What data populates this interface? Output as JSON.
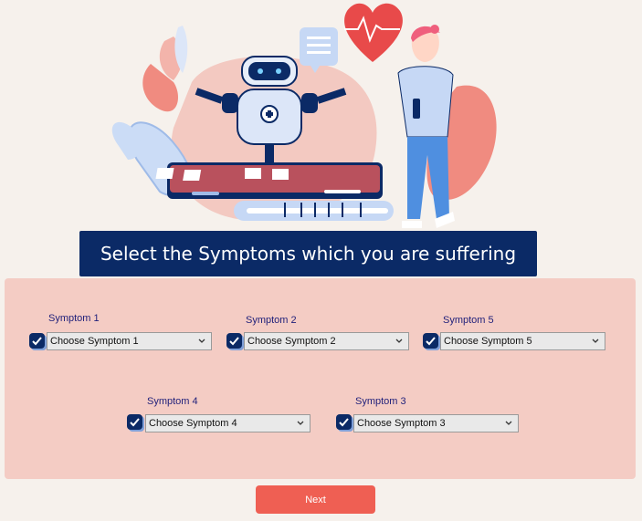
{
  "header": {
    "title": "Select the Symptoms which you are suffering"
  },
  "fields": [
    {
      "id": "s1",
      "label": "Symptom 1",
      "value": "Choose Symptom 1"
    },
    {
      "id": "s2",
      "label": "Symptom 2",
      "value": "Choose Symptom 2"
    },
    {
      "id": "s5",
      "label": "Symptom 5",
      "value": "Choose Symptom 5"
    },
    {
      "id": "s4",
      "label": "Symptom 4",
      "value": "Choose Symptom 4"
    },
    {
      "id": "s3",
      "label": "Symptom 3",
      "value": "Choose Symptom 3"
    }
  ],
  "next_button": {
    "label": "Next"
  },
  "icons": [
    "heart-icon",
    "chat-bubble-icon",
    "robot-icon",
    "phone-icon",
    "checkbox-icon",
    "chevron-down-icon"
  ],
  "colors": {
    "navy": "#0b2a66",
    "panel": "#f4ccc4",
    "accent": "#ef5f53",
    "background": "#f6f1ec"
  }
}
